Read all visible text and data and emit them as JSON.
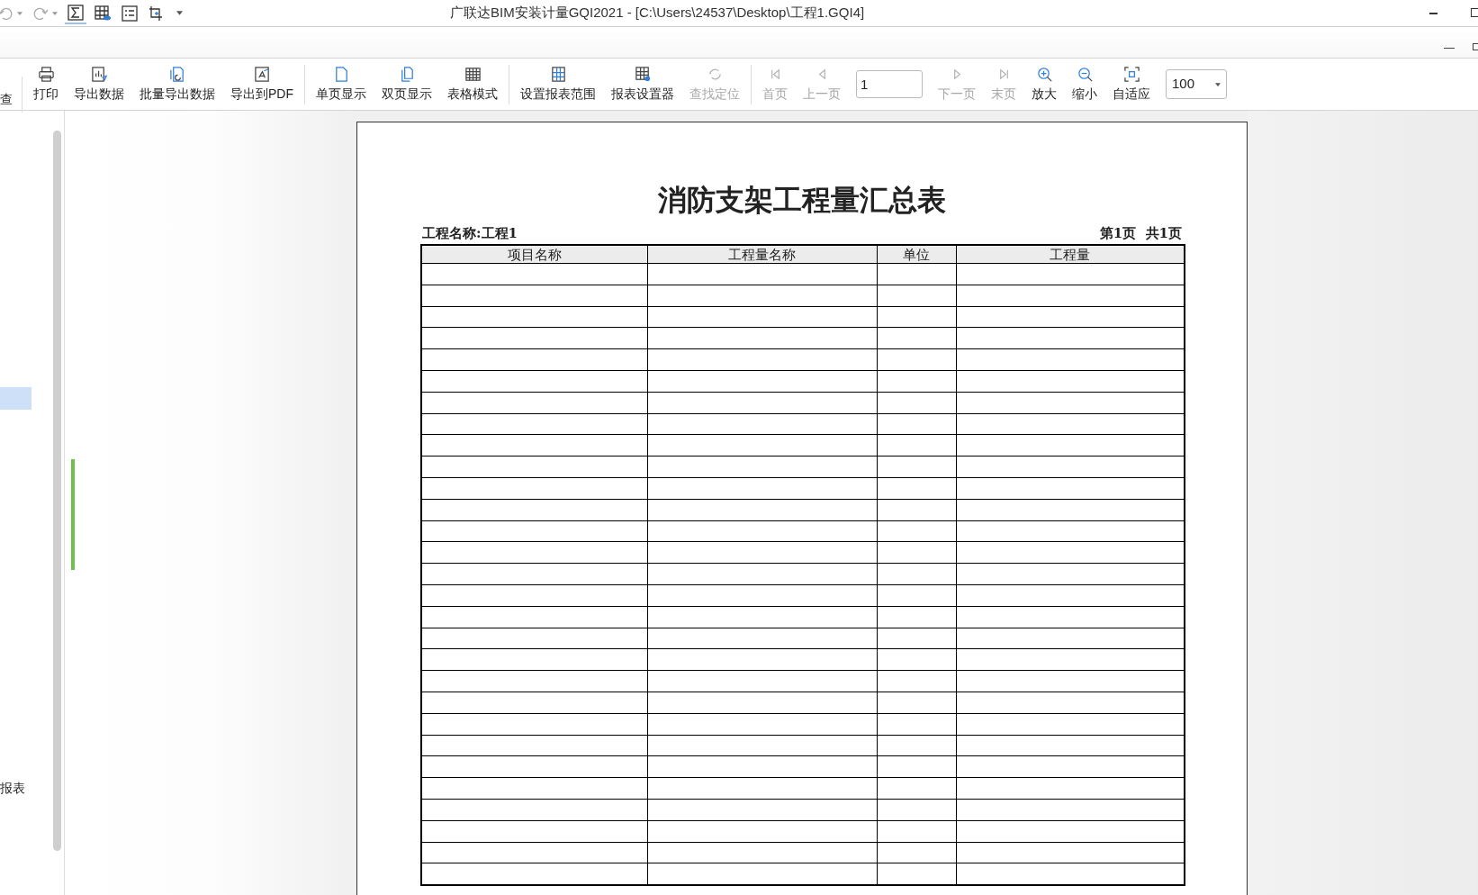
{
  "window": {
    "title": "广联达BIM安装计量GQI2021 - [C:\\Users\\24537\\Desktop\\工程1.GQI4]"
  },
  "quick_access": [
    {
      "kind": "undo"
    },
    {
      "kind": "redo"
    },
    {
      "kind": "sigma",
      "selected": true
    },
    {
      "kind": "table-eye",
      "selected": false
    },
    {
      "kind": "list",
      "selected": false
    },
    {
      "kind": "crop",
      "selected": false
    }
  ],
  "toolbar": {
    "cut_item": "查",
    "groups": [
      [
        {
          "kind": "print",
          "label": "打印",
          "disabled": false
        },
        {
          "kind": "export",
          "label": "导出数据",
          "disabled": false
        },
        {
          "kind": "batch",
          "label": "批量导出数据",
          "disabled": false
        },
        {
          "kind": "pdf",
          "label": "导出到PDF",
          "disabled": false
        }
      ],
      [
        {
          "kind": "single",
          "label": "单页显示",
          "disabled": false
        },
        {
          "kind": "double",
          "label": "双页显示",
          "disabled": false
        },
        {
          "kind": "grid",
          "label": "表格模式",
          "disabled": false
        }
      ],
      [
        {
          "kind": "range",
          "label": "设置报表范围",
          "disabled": false
        },
        {
          "kind": "settings",
          "label": "报表设置器",
          "disabled": false
        },
        {
          "kind": "locate",
          "label": "查找定位",
          "disabled": true
        }
      ],
      [
        {
          "kind": "first",
          "label": "首页",
          "disabled": true
        },
        {
          "kind": "prev",
          "label": "上一页",
          "disabled": true
        },
        {
          "kind": "page-input",
          "value": "1"
        },
        {
          "kind": "next",
          "label": "下一页",
          "disabled": true
        },
        {
          "kind": "last",
          "label": "末页",
          "disabled": true
        },
        {
          "kind": "zoom-in",
          "label": "放大",
          "disabled": false
        },
        {
          "kind": "zoom-out",
          "label": "缩小",
          "disabled": false
        },
        {
          "kind": "fit",
          "label": "自适应",
          "disabled": false
        },
        {
          "kind": "zoom-select",
          "value": "100"
        }
      ]
    ]
  },
  "sidebar": {
    "items": [
      {
        "selected": true
      },
      {
        "label": "报表",
        "selected": false
      }
    ]
  },
  "report": {
    "title": "消防支架工程量汇总表",
    "project": "工程名称:工程1",
    "page_info": "第1页  共1页",
    "columns": [
      "项目名称",
      "工程量名称",
      "单位",
      "工程量"
    ]
  }
}
